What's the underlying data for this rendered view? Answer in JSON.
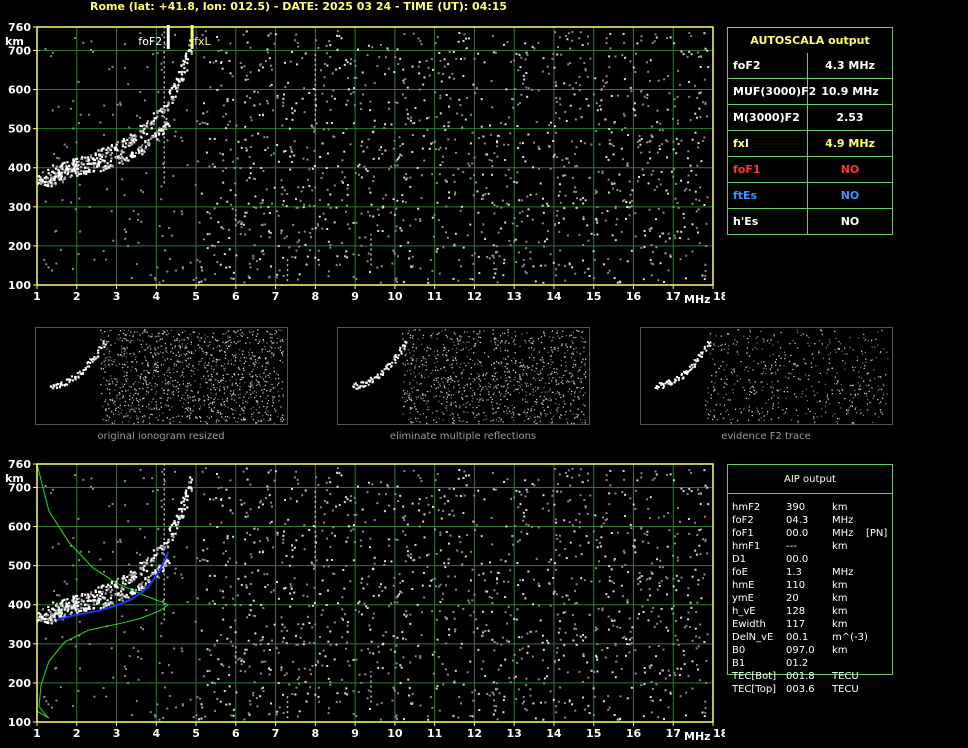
{
  "header": "Rome (lat: +41.8, lon: 012.5) - DATE: 2025 03 24 - TIME (UT): 04:15",
  "colors": {
    "axis": "#ffff66",
    "grid": "#2f7a2f",
    "panel_border": "#66cc66",
    "red": "#ff3333",
    "blue": "#3399ff",
    "yellow": "#ffff66",
    "profile": "#22dd22",
    "trace": "#2233ff"
  },
  "chart_data": [
    {
      "type": "scatter",
      "name_ref": "top-ionogram",
      "xlabel": "MHz",
      "ylabel": "km",
      "xlim": [
        1,
        18
      ],
      "ylim": [
        100,
        760
      ],
      "xticks": [
        "1",
        "2",
        "3",
        "4",
        "5",
        "6",
        "7",
        "8",
        "9",
        "10",
        "11",
        "12",
        "13",
        "14",
        "15",
        "16",
        "17",
        "18"
      ],
      "yticks": [
        "100",
        "200",
        "300",
        "400",
        "500",
        "600",
        "700",
        "760"
      ],
      "grid": true,
      "markers": [
        {
          "label": "foF2",
          "x": 4.3,
          "color": "#ffffff"
        },
        {
          "label": "fxL",
          "x": 4.9,
          "color": "#ffff66"
        }
      ],
      "traces": [
        {
          "name": "o-trace",
          "points": [
            [
              1.0,
              372
            ],
            [
              1.3,
              365
            ],
            [
              1.6,
              385
            ],
            [
              2.0,
              395
            ],
            [
              2.5,
              405
            ],
            [
              3.0,
              420
            ],
            [
              3.5,
              445
            ],
            [
              4.0,
              480
            ],
            [
              4.3,
              520
            ]
          ]
        },
        {
          "name": "x-trace",
          "points": [
            [
              1.3,
              395
            ],
            [
              1.8,
              408
            ],
            [
              2.3,
              425
            ],
            [
              2.8,
              445
            ],
            [
              3.3,
              470
            ],
            [
              3.8,
              510
            ],
            [
              4.3,
              570
            ],
            [
              4.6,
              640
            ],
            [
              4.9,
              720
            ]
          ]
        }
      ]
    },
    {
      "type": "scatter",
      "name_ref": "bottom-ionogram",
      "xlabel": "MHz",
      "ylabel": "km",
      "xlim": [
        1,
        18
      ],
      "ylim": [
        100,
        760
      ],
      "xticks": [
        "1",
        "2",
        "3",
        "4",
        "5",
        "6",
        "7",
        "8",
        "9",
        "10",
        "11",
        "12",
        "13",
        "14",
        "15",
        "16",
        "17",
        "18"
      ],
      "yticks": [
        "100",
        "200",
        "300",
        "400",
        "500",
        "600",
        "700",
        "760"
      ],
      "grid": true,
      "traces": [
        {
          "name": "o-trace",
          "points": [
            [
              1.0,
              372
            ],
            [
              1.3,
              365
            ],
            [
              1.6,
              385
            ],
            [
              2.0,
              395
            ],
            [
              2.5,
              405
            ],
            [
              3.0,
              420
            ],
            [
              3.5,
              445
            ],
            [
              4.0,
              480
            ],
            [
              4.3,
              520
            ]
          ]
        },
        {
          "name": "x-trace",
          "points": [
            [
              1.3,
              395
            ],
            [
              1.8,
              408
            ],
            [
              2.3,
              425
            ],
            [
              2.8,
              445
            ],
            [
              3.3,
              470
            ],
            [
              3.8,
              510
            ],
            [
              4.3,
              570
            ],
            [
              4.6,
              640
            ],
            [
              4.9,
              720
            ]
          ]
        }
      ],
      "fitted_trace": [
        [
          1.5,
          360
        ],
        [
          1.8,
          370
        ],
        [
          2.2,
          378
        ],
        [
          2.6,
          386
        ],
        [
          3.0,
          398
        ],
        [
          3.4,
          415
        ],
        [
          3.8,
          445
        ],
        [
          4.1,
          490
        ],
        [
          4.3,
          535
        ]
      ],
      "profile": [
        [
          1.0,
          760
        ],
        [
          1.3,
          640
        ],
        [
          1.8,
          560
        ],
        [
          2.4,
          495
        ],
        [
          3.0,
          455
        ],
        [
          3.6,
          428
        ],
        [
          4.0,
          412
        ],
        [
          4.3,
          400
        ],
        [
          4.1,
          385
        ],
        [
          3.6,
          365
        ],
        [
          3.0,
          350
        ],
        [
          2.3,
          335
        ],
        [
          1.7,
          305
        ],
        [
          1.3,
          255
        ],
        [
          1.1,
          195
        ],
        [
          1.05,
          140
        ],
        [
          1.2,
          120
        ],
        [
          1.3,
          110
        ],
        [
          1.0,
          128
        ]
      ]
    }
  ],
  "autoscala": {
    "title": "AUTOSCALA output",
    "rows": [
      {
        "label": "foF2",
        "value": "4.3 MHz",
        "color": "#ffffff"
      },
      {
        "label": "MUF(3000)F2",
        "value": "10.9 MHz",
        "color": "#ffffff"
      },
      {
        "label": "M(3000)F2",
        "value": "2.53",
        "color": "#ffffff"
      },
      {
        "label": "fxI",
        "value": "4.9 MHz",
        "color": "#ffff66"
      },
      {
        "label": "foF1",
        "value": "NO",
        "color": "#ff3333"
      },
      {
        "label": "ftEs",
        "value": "NO",
        "color": "#3399ff"
      },
      {
        "label": "h'Es",
        "value": "NO",
        "color": "#ffffff"
      }
    ]
  },
  "thumbnails": [
    {
      "label": "original ionogram resized"
    },
    {
      "label": "eliminate multiple reflections"
    },
    {
      "label": "evidence F2 trace"
    }
  ],
  "aip": {
    "title": "AIP output",
    "rows": [
      {
        "name": "hmF2",
        "value": "390",
        "unit": "km",
        "extra": ""
      },
      {
        "name": "foF2",
        "value": "04.3",
        "unit": "MHz",
        "extra": ""
      },
      {
        "name": "foF1",
        "value": "00.0",
        "unit": "MHz",
        "extra": "[PN]"
      },
      {
        "name": "hmF1",
        "value": "---",
        "unit": "km",
        "extra": ""
      },
      {
        "name": "D1",
        "value": "00.0",
        "unit": "",
        "extra": ""
      },
      {
        "name": "foE",
        "value": "1.3",
        "unit": "MHz",
        "extra": ""
      },
      {
        "name": "hmE",
        "value": "110",
        "unit": "km",
        "extra": ""
      },
      {
        "name": "ymE",
        "value": "20",
        "unit": "km",
        "extra": ""
      },
      {
        "name": "h_vE",
        "value": "128",
        "unit": "km",
        "extra": ""
      },
      {
        "name": "Ewidth",
        "value": "117",
        "unit": "km",
        "extra": ""
      },
      {
        "name": "DelN_vE",
        "value": "00.1",
        "unit": "m^(-3)",
        "extra": ""
      },
      {
        "name": "B0",
        "value": "097.0",
        "unit": "km",
        "extra": ""
      },
      {
        "name": "B1",
        "value": "01.2",
        "unit": "",
        "extra": ""
      },
      {
        "name": "TEC[Bot]",
        "value": "001.8",
        "unit": "TECU",
        "extra": ""
      },
      {
        "name": "TEC[Top]",
        "value": "003.6",
        "unit": "TECU",
        "extra": ""
      }
    ]
  }
}
